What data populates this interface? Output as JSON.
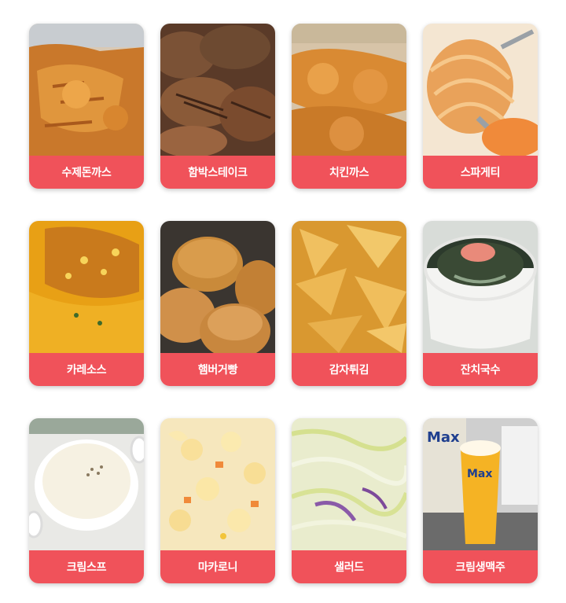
{
  "colors": {
    "label_bg": "#f0525a",
    "label_text": "#ffffff"
  },
  "menu": [
    {
      "label": "수제돈까스",
      "icon": "pork-cutlet-photo"
    },
    {
      "label": "함박스테이크",
      "icon": "hamburg-steak-photo"
    },
    {
      "label": "치킨까스",
      "icon": "chicken-cutlet-photo"
    },
    {
      "label": "스파게티",
      "icon": "spaghetti-photo"
    },
    {
      "label": "카레소스",
      "icon": "curry-sauce-photo"
    },
    {
      "label": "햄버거빵",
      "icon": "burger-bun-photo"
    },
    {
      "label": "감자튀김",
      "icon": "potato-wedges-photo"
    },
    {
      "label": "잔치국수",
      "icon": "noodle-soup-photo"
    },
    {
      "label": "크림스프",
      "icon": "cream-soup-photo"
    },
    {
      "label": "마카로니",
      "icon": "macaroni-salad-photo"
    },
    {
      "label": "샐러드",
      "icon": "cabbage-salad-photo"
    },
    {
      "label": "크림생맥주",
      "icon": "draft-beer-photo"
    }
  ]
}
